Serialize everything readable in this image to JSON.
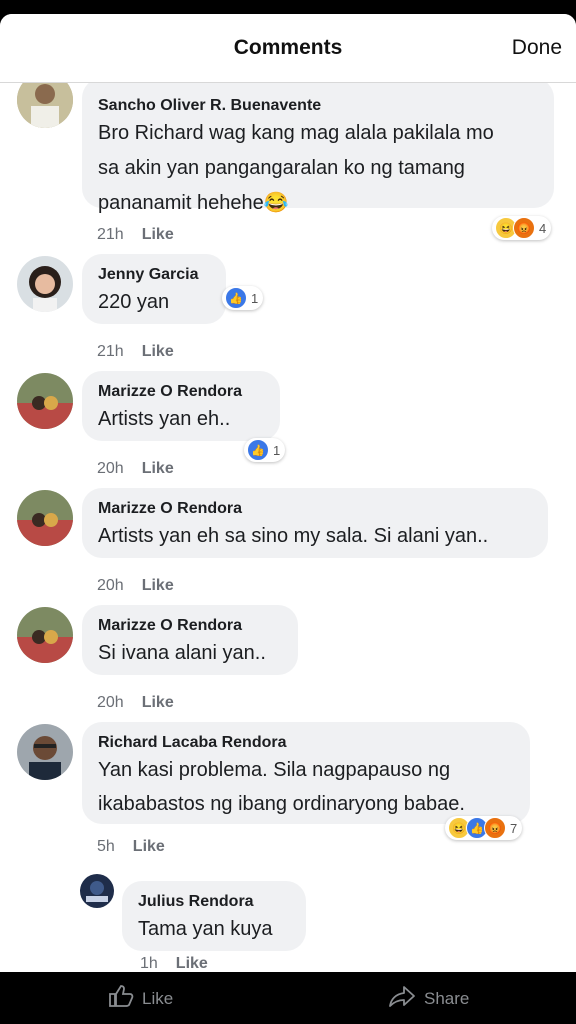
{
  "header": {
    "title": "Comments",
    "done_label": "Done"
  },
  "comments": [
    {
      "name": "Sancho Oliver R. Buenavente",
      "text": "Bro Richard wag kang mag alala pakilala mo\nsa akin yan pangangaralan ko ng tamang\npananamit hehehe😂",
      "time": "21h",
      "like_label": "Like",
      "reaction_count": "4"
    },
    {
      "name": "Jenny Garcia",
      "text": "220 yan",
      "time": "21h",
      "like_label": "Like",
      "reaction_count": "1"
    },
    {
      "name": "Marizze O Rendora",
      "text": "Artists yan eh..",
      "time": "20h",
      "like_label": "Like",
      "reaction_count": "1"
    },
    {
      "name": "Marizze O Rendora",
      "text": "Artists yan eh sa sino my sala. Si alani yan..",
      "time": "20h",
      "like_label": "Like"
    },
    {
      "name": "Marizze O Rendora",
      "text": "Si ivana alani yan..",
      "time": "20h",
      "like_label": "Like"
    },
    {
      "name": "Richard Lacaba Rendora",
      "text": "Yan kasi problema. Sila nagpapauso ng\nikababastos ng ibang ordinaryong babae.",
      "time": "5h",
      "like_label": "Like",
      "reaction_count": "7"
    },
    {
      "name": "Julius Rendora",
      "text": "Tama yan kuya",
      "time": "1h",
      "like_label": "Like"
    }
  ],
  "bottom_bar": {
    "like_label": "Like",
    "share_label": "Share"
  }
}
